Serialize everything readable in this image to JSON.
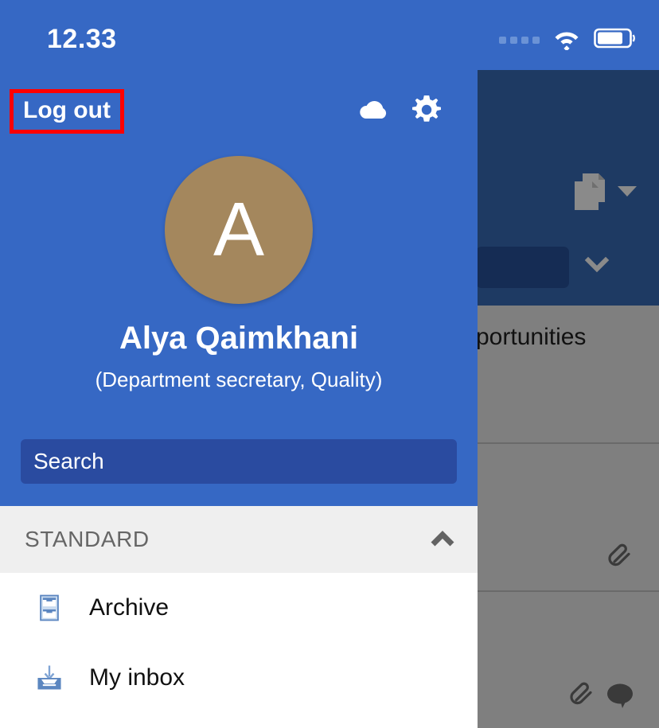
{
  "status_bar": {
    "time": "12.33",
    "signal_dots": 4,
    "wifi_icon": "wifi-icon",
    "battery_icon": "battery-icon",
    "battery_level_percent": 75
  },
  "drawer": {
    "logout": {
      "label": "Log out",
      "highlight_color": "#ff0000"
    },
    "header_icons": [
      {
        "name": "cloud-icon"
      },
      {
        "name": "gear-icon"
      }
    ],
    "profile": {
      "avatar_initial": "A",
      "avatar_color": "#a4875d",
      "name": "Alya Qaimkhani",
      "role": "(Department secretary, Quality)"
    },
    "search": {
      "value": "",
      "placeholder": "Search"
    },
    "section": {
      "title": "STANDARD",
      "collapse_icon": "chevron-up-icon",
      "expanded": true
    },
    "nav_items": [
      {
        "label": "Archive",
        "icon": "archive-cabinet-icon"
      },
      {
        "label": "My inbox",
        "icon": "inbox-tray-icon"
      }
    ],
    "background_color": "#3668c4",
    "search_field_color": "#2a4ba0",
    "section_header_color": "#efefef"
  },
  "background_app": {
    "appbar_color": "#1e3a63",
    "overlay_color": "#7f7f7f",
    "card_title": "portunities",
    "appbar_icons": [
      {
        "name": "documents-icon"
      },
      {
        "name": "caret-down-icon"
      },
      {
        "name": "chevron-down-icon"
      }
    ],
    "list_icons": [
      {
        "name": "paperclip-icon"
      },
      {
        "name": "paperclip-icon"
      },
      {
        "name": "comment-bubble-icon"
      }
    ]
  }
}
